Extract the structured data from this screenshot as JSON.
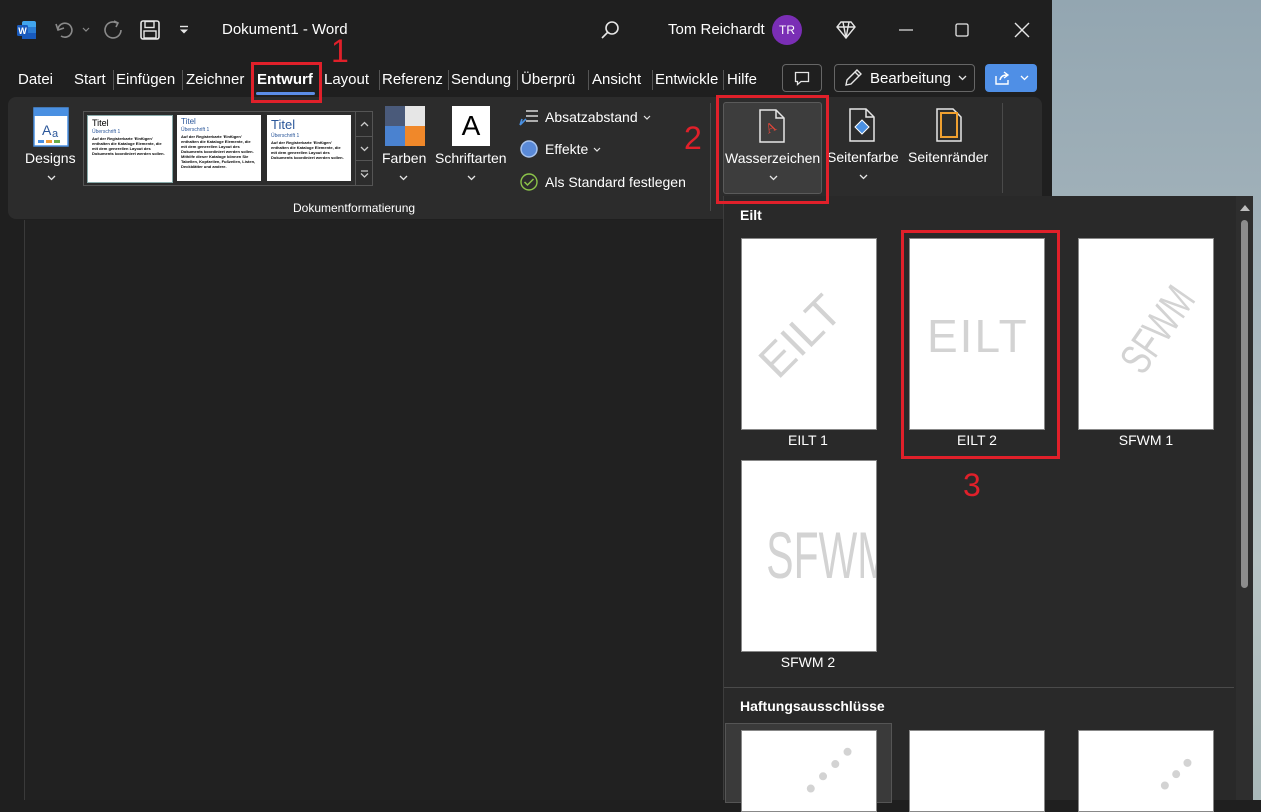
{
  "titlebar": {
    "doc_title": "Dokument1 - Word",
    "user_name": "Tom Reichardt",
    "user_initials": "TR",
    "avatar_color": "#7a2eb5"
  },
  "menu": {
    "tabs": [
      "Datei",
      "Start",
      "Einfügen",
      "Zeichner",
      "Entwurf",
      "Layout",
      "Referenz",
      "Sendung",
      "Überprü",
      "Ansicht",
      "Entwickle",
      "Hilfe"
    ],
    "active": "Entwurf",
    "edit_mode": "Bearbeitung"
  },
  "ribbon": {
    "designs_label": "Designs",
    "style_thumbs": [
      {
        "title": "Titel",
        "heading": "Überschrift 1",
        "body": "Auf der Registerkarte 'Einfügen' enthalten die Kataloge Elemente, die mit dem generellen Layout des Dokuments koordiniert werden sollen."
      },
      {
        "title": "Titel",
        "heading": "Überschrift 1",
        "body": "Auf der Registerkarte 'Einfügen' enthalten die Kataloge Elemente, die mit dem generellen Layout des Dokuments koordiniert werden sollen. Mithilfe dieser Kataloge können Sie Tabellen, Kopfzeilen, Fußzeilen, Listen, Deckblätter und andere."
      },
      {
        "title": "Titel",
        "heading": "Überschrift 1",
        "body": "Auf der Registerkarte 'Einfügen' enthalten die Kataloge Elemente, die mit dem generellen Layout des Dokuments koordiniert werden sollen."
      }
    ],
    "farben_label": "Farben",
    "schriftarten_label": "Schriftarten",
    "absatzabstand_label": "Absatzabstand",
    "effekte_label": "Effekte",
    "standard_label": "Als Standard festlegen",
    "group_label": "Dokumentformatierung",
    "wasserzeichen_label": "Wasserzeichen",
    "seitenfarbe_label": "Seitenfarbe",
    "seitenraender_label": "Seitenränder"
  },
  "watermark_panel": {
    "section1": "Eilt",
    "section2": "Haftungsausschlüsse",
    "items": [
      {
        "label": "EILT 1",
        "text": "EILT"
      },
      {
        "label": "EILT 2",
        "text": "EILT"
      },
      {
        "label": "SFWM 1",
        "text": "SFWM"
      },
      {
        "label": "SFWM 2",
        "text": "SFWM"
      }
    ]
  },
  "annotations": {
    "n1": "1",
    "n2": "2",
    "n3": "3",
    "color": "#e0202a"
  }
}
